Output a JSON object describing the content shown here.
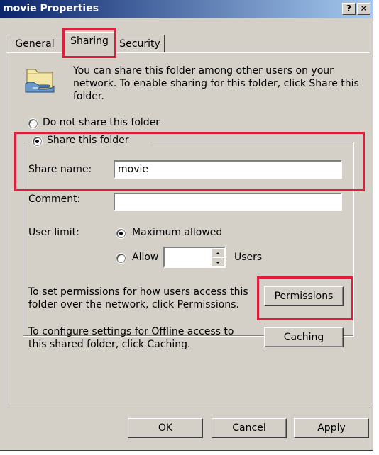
{
  "window": {
    "title": "movie Properties",
    "help_label": "?",
    "close_label": "✕"
  },
  "tabs": [
    {
      "label": "General"
    },
    {
      "label": "Sharing"
    },
    {
      "label": "Security"
    }
  ],
  "intro": {
    "line1": "You can share this folder among other users on your",
    "line2": "network.  To enable sharing for this folder, click Share this",
    "line3": "folder.",
    "icon": "shared-folder-icon"
  },
  "sharing": {
    "do_not_share_label": "Do not share this folder",
    "share_label": "Share this folder",
    "selected": "share"
  },
  "share_name": {
    "label": "Share name:",
    "value": "movie"
  },
  "comment": {
    "label": "Comment:",
    "value": ""
  },
  "user_limit": {
    "label": "User limit:",
    "maximum_label": "Maximum allowed",
    "allow_label": "Allow",
    "allow_value": "",
    "users_label": "Users",
    "selected": "maximum"
  },
  "permissions": {
    "text_line1": "To set permissions for how users access this",
    "text_line2": "folder over the network, click Permissions.",
    "button_label": "Permissions"
  },
  "caching": {
    "text_line1": "To configure settings for Offline access to",
    "text_line2": "this shared folder, click Caching.",
    "button_label": "Caching"
  },
  "footer": {
    "ok_label": "OK",
    "cancel_label": "Cancel",
    "apply_label": "Apply"
  },
  "colors": {
    "highlight": "#e01e3c",
    "title_start": "#0a246a",
    "title_end": "#a6caf0",
    "face": "#d4d0c8"
  }
}
